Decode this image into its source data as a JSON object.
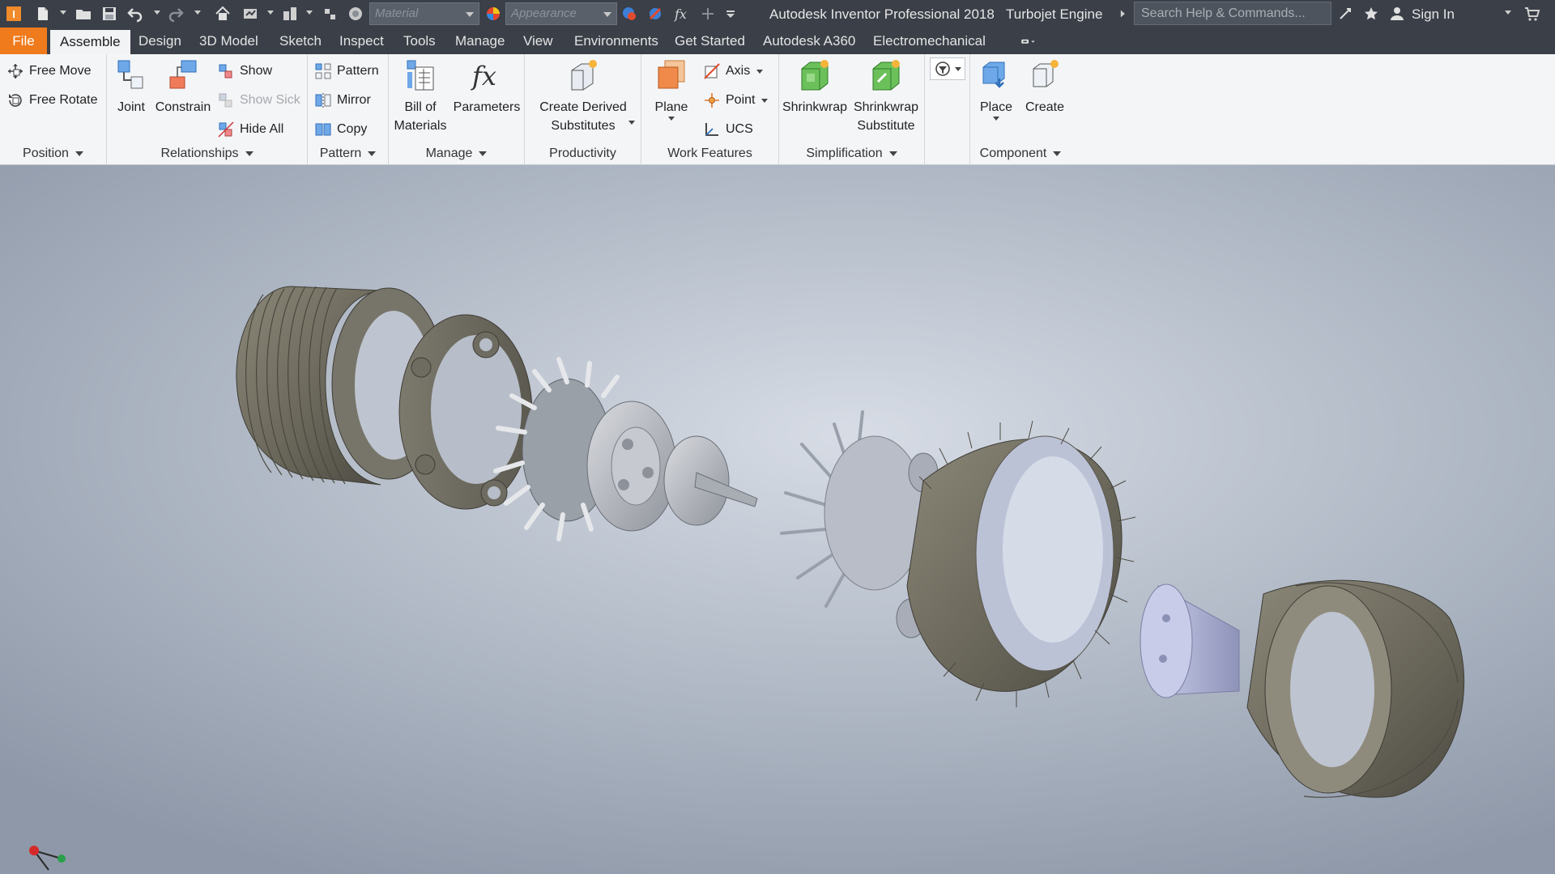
{
  "app": {
    "title": "Autodesk Inventor Professional 2018",
    "document": "Turbojet Engine",
    "material_placeholder": "Material",
    "appearance_placeholder": "Appearance",
    "search_placeholder": "Search Help & Commands...",
    "sign_in": "Sign In",
    "accent_color": "#f07b1d"
  },
  "tabs": [
    {
      "label": "File"
    },
    {
      "label": "Assemble",
      "active": true
    },
    {
      "label": "Design"
    },
    {
      "label": "3D Model"
    },
    {
      "label": "Sketch"
    },
    {
      "label": "Inspect"
    },
    {
      "label": "Tools"
    },
    {
      "label": "Manage"
    },
    {
      "label": "View"
    },
    {
      "label": "Environments"
    },
    {
      "label": "Get Started"
    },
    {
      "label": "Autodesk A360"
    },
    {
      "label": "Electromechanical"
    }
  ],
  "ribbon": {
    "position": {
      "label": "Position",
      "free_move": "Free Move",
      "free_rotate": "Free Rotate"
    },
    "relationships": {
      "label": "Relationships",
      "joint": "Joint",
      "constrain": "Constrain",
      "show": "Show",
      "show_sick": "Show Sick",
      "hide_all": "Hide All"
    },
    "pattern": {
      "label": "Pattern",
      "pattern": "Pattern",
      "mirror": "Mirror",
      "copy": "Copy"
    },
    "manage": {
      "label": "Manage",
      "bom_line1": "Bill of",
      "bom_line2": "Materials",
      "parameters": "Parameters"
    },
    "productivity": {
      "label": "Productivity",
      "derived_line1": "Create Derived",
      "derived_line2": "Substitutes"
    },
    "work_features": {
      "label": "Work Features",
      "plane": "Plane",
      "axis": "Axis",
      "point": "Point",
      "ucs": "UCS"
    },
    "simplification": {
      "label": "Simplification",
      "shrinkwrap": "Shrinkwrap",
      "shrinkwrap_sub_line1": "Shrinkwrap",
      "shrinkwrap_sub_line2": "Substitute"
    },
    "component": {
      "label": "Component",
      "place": "Place",
      "create": "Create"
    }
  }
}
